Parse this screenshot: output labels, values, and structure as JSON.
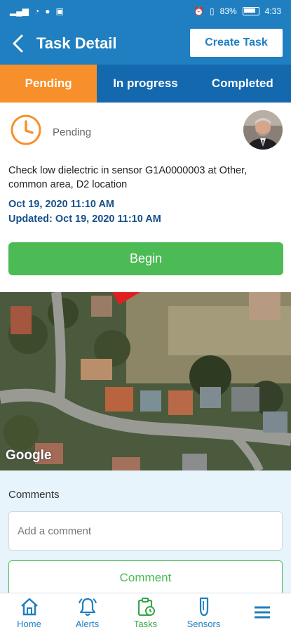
{
  "status_bar": {
    "battery": "83%",
    "time": "4:33"
  },
  "header": {
    "title": "Task Detail",
    "create_button": "Create Task"
  },
  "tabs": [
    {
      "label": "Pending",
      "active": true
    },
    {
      "label": "In progress",
      "active": false
    },
    {
      "label": "Completed",
      "active": false
    }
  ],
  "task": {
    "status": "Pending",
    "description": "Check low dielectric in sensor G1A0000003 at Other, common area, D2 location",
    "created": "Oct 19, 2020 11:10 AM",
    "updated": "Updated: Oct 19, 2020 11:10 AM",
    "begin_button": "Begin"
  },
  "map": {
    "attribution": "Google"
  },
  "comments": {
    "label": "Comments",
    "input_placeholder": "Add a comment",
    "submit_button": "Comment"
  },
  "bottom_nav": [
    {
      "label": "Home",
      "icon": "home-icon"
    },
    {
      "label": "Alerts",
      "icon": "bell-icon"
    },
    {
      "label": "Tasks",
      "icon": "tasks-icon"
    },
    {
      "label": "Sensors",
      "icon": "sensor-icon"
    },
    {
      "label": "",
      "icon": "menu-icon"
    }
  ],
  "colors": {
    "primary": "#1f7fc1",
    "tab_active": "#f7902a",
    "tab_inactive": "#1468ae",
    "success": "#4cbb55",
    "date_text": "#17508c"
  }
}
